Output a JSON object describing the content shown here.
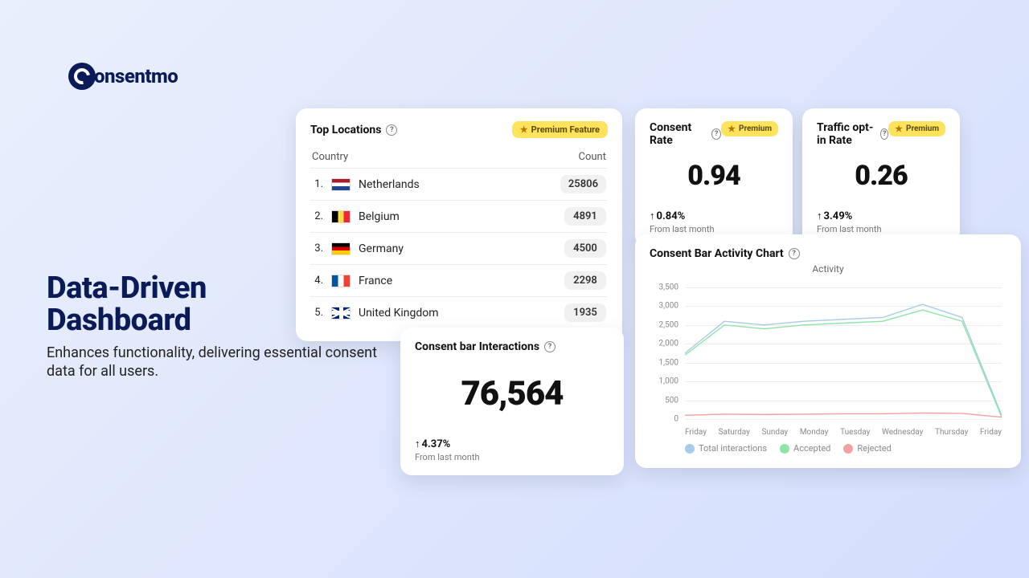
{
  "brand": {
    "name": "onsentmo"
  },
  "headline": {
    "title_line1": "Data-Driven",
    "title_line2": "Dashboard",
    "subtitle": "Enhances functionality, delivering essential consent data for all users."
  },
  "premium_label": "Premium Feature",
  "premium_short": "Premium",
  "top_locations": {
    "title": "Top Locations",
    "col_country": "Country",
    "col_count": "Count",
    "rows": [
      {
        "rank": "1.",
        "name": "Netherlands",
        "count": "25806"
      },
      {
        "rank": "2.",
        "name": "Belgium",
        "count": "4891"
      },
      {
        "rank": "3.",
        "name": "Germany",
        "count": "4500"
      },
      {
        "rank": "4.",
        "name": "France",
        "count": "2298"
      },
      {
        "rank": "5.",
        "name": "United Kingdom",
        "count": "1935"
      }
    ]
  },
  "consent_rate": {
    "title": "Consent Rate",
    "value": "0.94",
    "delta": "0.84%",
    "from": "From last month"
  },
  "traffic_rate": {
    "title": "Traffic opt-in Rate",
    "value": "0.26",
    "delta": "3.49%",
    "from": "From last month"
  },
  "interactions": {
    "title": "Consent bar Interactions",
    "value": "76,564",
    "delta": "4.37%",
    "from": "From last month"
  },
  "activity": {
    "title": "Consent Bar Activity Chart",
    "chart_title": "Activity",
    "legend": {
      "total": "Total interactions",
      "accepted": "Accepted",
      "rejected": "Rejected"
    },
    "colors": {
      "total": "#a7cbe8",
      "accepted": "#8de6a7",
      "rejected": "#f2a1a1"
    }
  },
  "chart_data": {
    "type": "line",
    "title": "Activity",
    "xlabel": "",
    "ylabel": "",
    "ylim": [
      0,
      3500
    ],
    "x": [
      "Friday",
      "Saturday",
      "Sunday",
      "Monday",
      "Tuesday",
      "Wednesday",
      "Thursday",
      "Friday"
    ],
    "series": [
      {
        "name": "Total interactions",
        "values": [
          1750,
          2600,
          2500,
          2600,
          2650,
          2700,
          3050,
          2700,
          100
        ]
      },
      {
        "name": "Accepted",
        "values": [
          1700,
          2500,
          2400,
          2500,
          2550,
          2600,
          2900,
          2600,
          50
        ]
      },
      {
        "name": "Rejected",
        "values": [
          100,
          130,
          120,
          130,
          140,
          140,
          160,
          150,
          50
        ]
      }
    ],
    "yticks": [
      0,
      500,
      1000,
      1500,
      2000,
      2500,
      3000,
      3500
    ]
  }
}
